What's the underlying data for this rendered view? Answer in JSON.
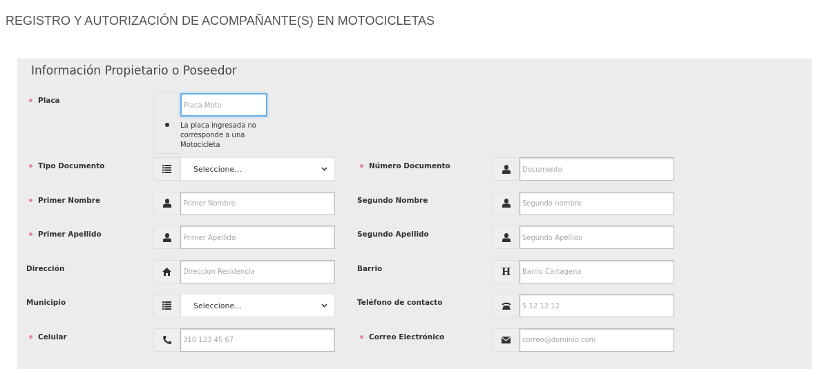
{
  "title": "REGISTRO Y AUTORIZACIÓN DE ACOMPAÑANTE(S) EN MOTOCICLETAS",
  "section": {
    "heading": "Información Propietario o Poseedor",
    "plate": {
      "label": "Placa",
      "required": true,
      "placeholder": "Placa Moto",
      "focused": true,
      "error": "La placa ingresada no corresponde a una Motocicleta"
    },
    "rows": [
      [
        {
          "label": "Tipo Documento",
          "required": true,
          "kind": "list-select",
          "value": "Seleccione..."
        },
        {
          "label": "Número Documento",
          "required": true,
          "kind": "person-input",
          "placeholder": "Documento"
        }
      ],
      [
        {
          "label": "Primer Nombre",
          "required": true,
          "kind": "person-input",
          "placeholder": "Primer Nombre"
        },
        {
          "label": "Segundo Nombre",
          "required": false,
          "kind": "person-input",
          "placeholder": "Segundo nombre"
        }
      ],
      [
        {
          "label": "Primer Apellido",
          "required": true,
          "kind": "person-input",
          "placeholder": "Primer Apellido"
        },
        {
          "label": "Segundo Apellido",
          "required": false,
          "kind": "person-input",
          "placeholder": "Segundo Apellido"
        }
      ],
      [
        {
          "label": "Dirección",
          "required": false,
          "kind": "home-input",
          "placeholder": "Direccion Residencia"
        },
        {
          "label": "Barrio",
          "required": false,
          "kind": "letter-input",
          "glyph": "H",
          "placeholder": "Barrio Cartagena"
        }
      ],
      [
        {
          "label": "Municipio",
          "required": false,
          "kind": "list-select",
          "value": "Seleccione..."
        },
        {
          "label": "Teléfono de contacto",
          "required": false,
          "kind": "deskphone-input",
          "placeholder": "5 12 12 12"
        }
      ],
      [
        {
          "label": "Celular",
          "required": true,
          "kind": "phone-input",
          "placeholder": "310 123 45 67"
        },
        {
          "label": "Correo Electrónico",
          "required": true,
          "kind": "email-input",
          "placeholder": "correo@dominio.com"
        }
      ]
    ]
  }
}
